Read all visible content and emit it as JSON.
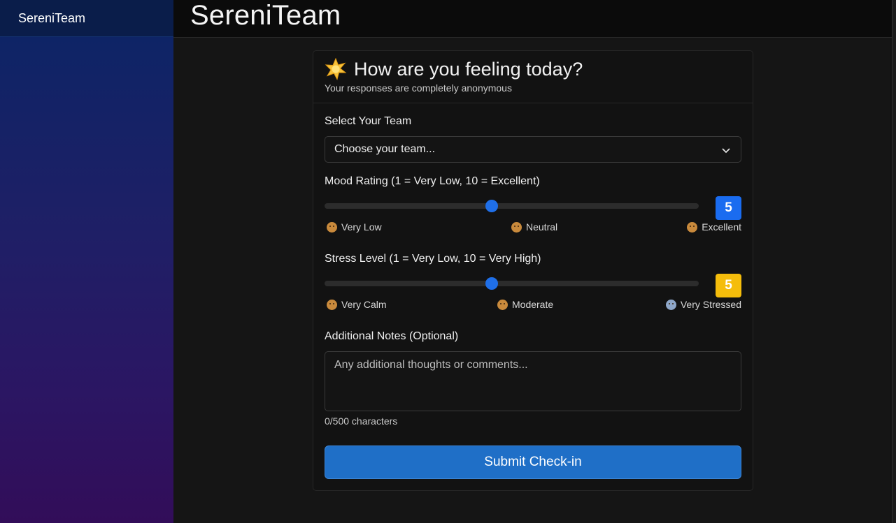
{
  "sidebar": {
    "brand": "SereniTeam"
  },
  "topbar": {
    "title": "SereniTeam"
  },
  "card": {
    "title": "How are you feeling today?",
    "subtitle": "Your responses are completely anonymous"
  },
  "team": {
    "label": "Select Your Team",
    "selected": "Choose your team..."
  },
  "mood": {
    "label": "Mood Rating (1 = Very Low, 10 = Excellent)",
    "value": "5",
    "fraction": 0.447,
    "scale": [
      "Very Low",
      "Neutral",
      "Excellent"
    ]
  },
  "stress": {
    "label": "Stress Level (1 = Very Low, 10 = Very High)",
    "value": "5",
    "fraction": 0.447,
    "scale": [
      "Very Calm",
      "Moderate",
      "Very Stressed"
    ]
  },
  "notes": {
    "label": "Additional Notes (Optional)",
    "placeholder": "Any additional thoughts or comments...",
    "counter": "0/500 characters"
  },
  "submit_label": "Submit Check-in",
  "icons": {
    "title": "star-icon",
    "select": "chevron-down-icon",
    "scale_emoji": "face-emoji-icon"
  },
  "colors": {
    "accent": "#1f6fe8",
    "mood_badge": "#1a6cf0",
    "stress_badge": "#f5bd0b",
    "submit": "#1f6fc7"
  }
}
